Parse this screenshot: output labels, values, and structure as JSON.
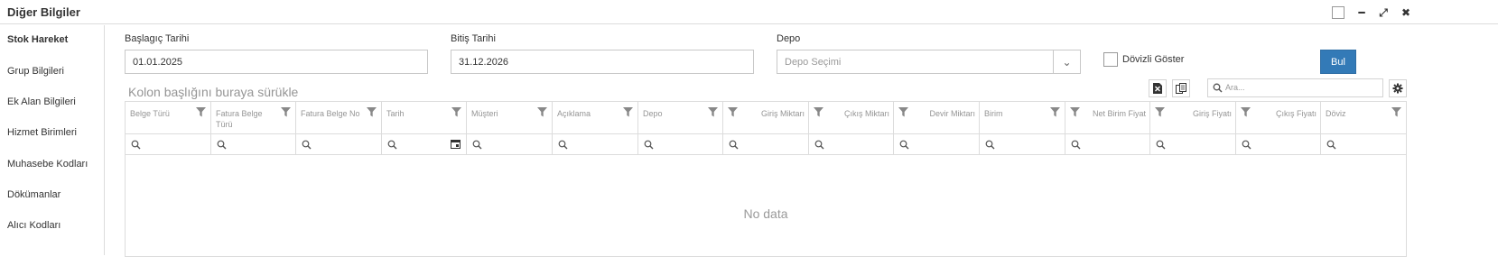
{
  "window": {
    "title": "Diğer Bilgiler",
    "controls": [
      "restore-icon",
      "minimize-icon",
      "maximize-icon",
      "close-icon"
    ],
    "minimize_glyph": "━",
    "maximize_glyph": "⤢",
    "close_glyph": "✖"
  },
  "sidebar": {
    "items": [
      {
        "label": "Stok Hareket",
        "active": true
      },
      {
        "label": "Grup Bilgileri"
      },
      {
        "label": "Ek Alan Bilgileri"
      },
      {
        "label": "Hizmet Birimleri"
      },
      {
        "label": "Muhasebe Kodları"
      },
      {
        "label": "Dökümanlar"
      },
      {
        "label": "Alıcı Kodları"
      }
    ]
  },
  "form": {
    "start_label": "Başlagıç Tarihi",
    "start_value": "01.01.2025",
    "end_label": "Bitiş Tarihi",
    "end_value": "31.12.2026",
    "depot_label": "Depo",
    "depot_placeholder": "Depo Seçimi",
    "depot_arrow": "⌄",
    "currency_label": "Dövizli Göster",
    "currency_checked": false,
    "search_button": "Bul"
  },
  "colors": {
    "accent": "#337ab7",
    "border": "#dcdcdc",
    "header_text": "#959595"
  },
  "grid": {
    "group_panel_text": "Kolon başlığını buraya sürükle",
    "search_placeholder": "Ara...",
    "toolbar_icons": [
      "excel-export-icon",
      "column-chooser-icon",
      "settings-icon"
    ],
    "columns": [
      {
        "line1": "Belge Türü",
        "line2": ""
      },
      {
        "line1": "Fatura Belge",
        "line2": "Türü"
      },
      {
        "line1": "Fatura Belge No",
        "line2": ""
      },
      {
        "line1": "Tarih",
        "line2": ""
      },
      {
        "line1": "Müşteri",
        "line2": ""
      },
      {
        "line1": "Açıklama",
        "line2": ""
      },
      {
        "line1": "Depo",
        "line2": ""
      },
      {
        "line1": "Giriş Miktarı",
        "line2": ""
      },
      {
        "line1": "Çıkış Miktarı",
        "line2": ""
      },
      {
        "line1": "Devir Miktarı",
        "line2": ""
      },
      {
        "line1": "Birim",
        "line2": ""
      },
      {
        "line1": "Net Birim Fiyat",
        "line2": ""
      },
      {
        "line1": "Giriş Fiyatı",
        "line2": ""
      },
      {
        "line1": "Çıkış Fiyatı",
        "line2": ""
      },
      {
        "line1": "Döviz",
        "line2": ""
      }
    ],
    "rows": [],
    "no_data_text": "No data"
  }
}
